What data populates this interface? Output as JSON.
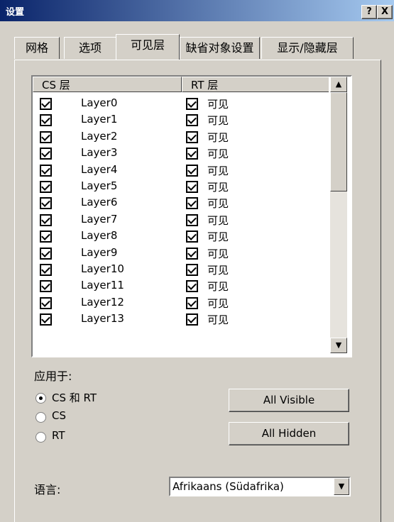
{
  "window": {
    "title": "设置",
    "help_label": "?",
    "close_label": "X"
  },
  "tabs": [
    {
      "label": "网格",
      "active": false
    },
    {
      "label": "选项",
      "active": false
    },
    {
      "label": "可见层",
      "active": true
    },
    {
      "label": "缺省对象设置",
      "active": false
    },
    {
      "label": "显示/隐藏层",
      "active": false
    }
  ],
  "layer_list": {
    "headers": {
      "cs": "CS 层",
      "rt": "RT 层"
    },
    "rows": [
      {
        "name": "Layer0",
        "visibility": "可见"
      },
      {
        "name": "Layer1",
        "visibility": "可见"
      },
      {
        "name": "Layer2",
        "visibility": "可见"
      },
      {
        "name": "Layer3",
        "visibility": "可见"
      },
      {
        "name": "Layer4",
        "visibility": "可见"
      },
      {
        "name": "Layer5",
        "visibility": "可见"
      },
      {
        "name": "Layer6",
        "visibility": "可见"
      },
      {
        "name": "Layer7",
        "visibility": "可见"
      },
      {
        "name": "Layer8",
        "visibility": "可见"
      },
      {
        "name": "Layer9",
        "visibility": "可见"
      },
      {
        "name": "Layer10",
        "visibility": "可见"
      },
      {
        "name": "Layer11",
        "visibility": "可见"
      },
      {
        "name": "Layer12",
        "visibility": "可见"
      },
      {
        "name": "Layer13",
        "visibility": "可见"
      }
    ]
  },
  "apply_to": {
    "label": "应用于:",
    "options": [
      {
        "label": "CS 和 RT",
        "checked": true
      },
      {
        "label": "CS",
        "checked": false
      },
      {
        "label": "RT",
        "checked": false
      }
    ]
  },
  "buttons": {
    "all_visible": "All Visible",
    "all_hidden": "All Hidden"
  },
  "language": {
    "label": "语言:",
    "value": "Afrikaans (Südafrika)"
  },
  "icons": {
    "scroll_up": "▲",
    "scroll_down": "▼",
    "dropdown": "▼"
  }
}
